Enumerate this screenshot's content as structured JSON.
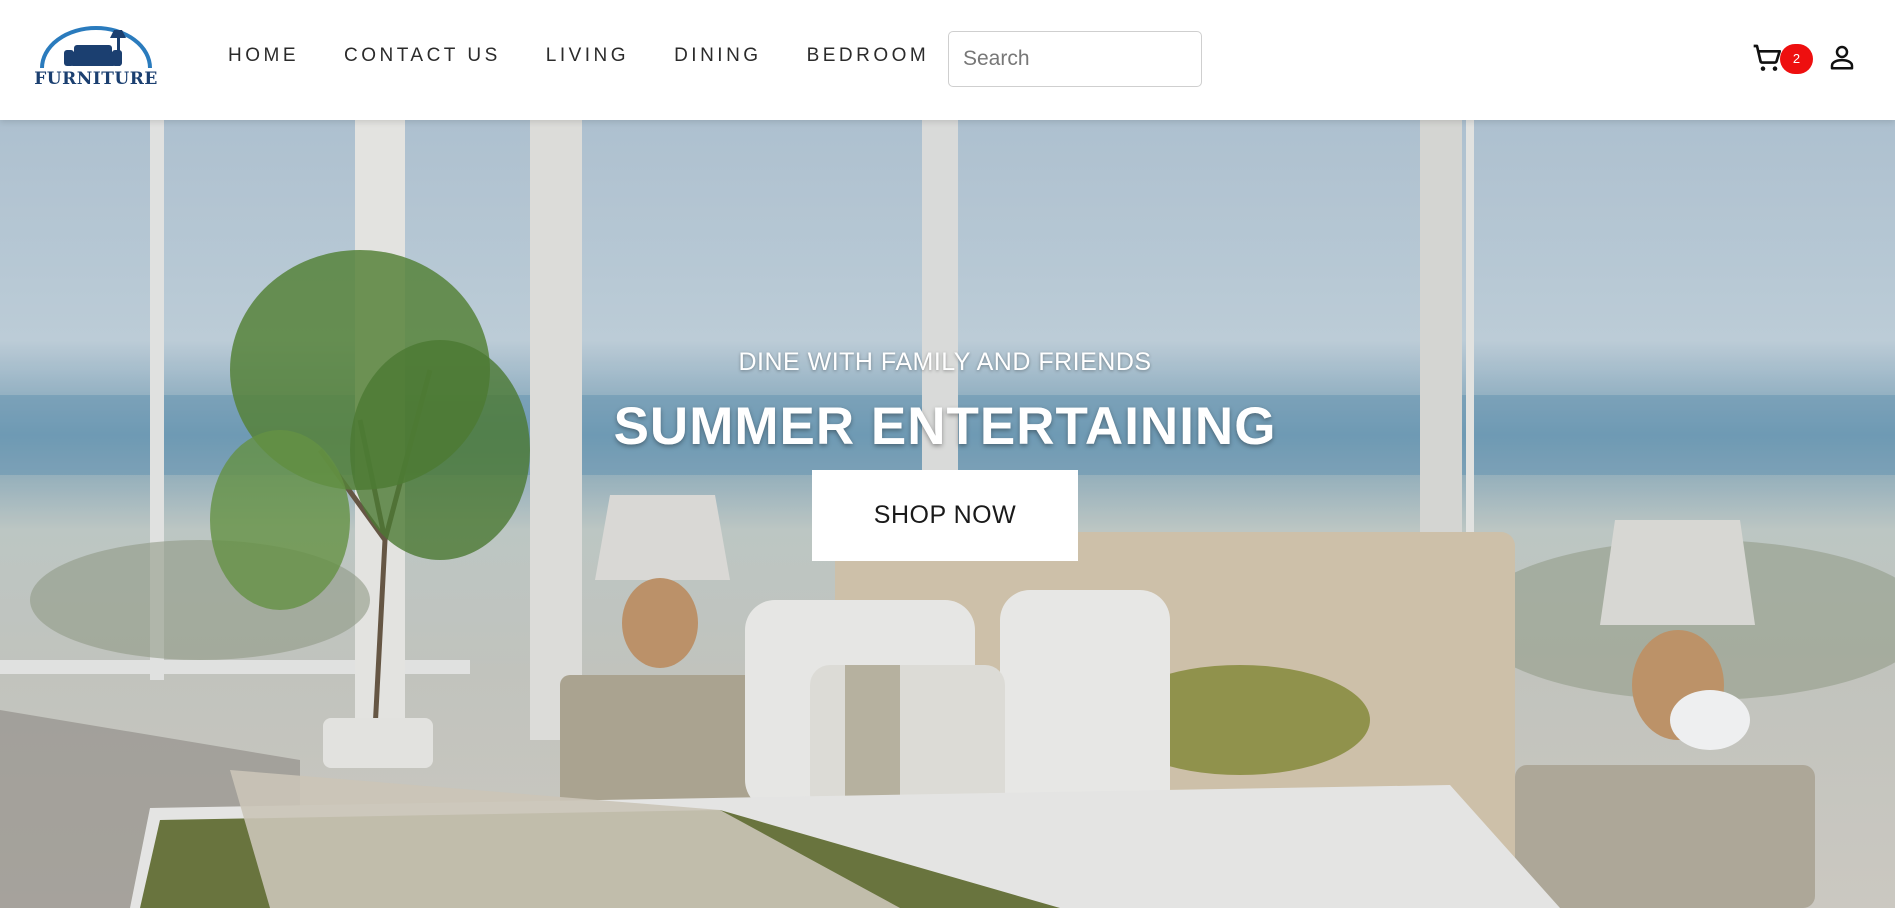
{
  "brand": {
    "logo_text": "FURNITURE",
    "primary_color": "#1b3f70",
    "accent_color": "#2a7bbd"
  },
  "nav": {
    "items": [
      {
        "label": "HOME"
      },
      {
        "label": "CONTACT US"
      },
      {
        "label": "LIVING"
      },
      {
        "label": "DINING"
      },
      {
        "label": "BEDROOM"
      }
    ]
  },
  "search": {
    "placeholder": "Search",
    "value": ""
  },
  "cart": {
    "icon": "cart-icon",
    "count": "2",
    "badge_color": "#ee0f0f"
  },
  "account": {
    "icon": "user-icon"
  },
  "hero": {
    "subtitle": "DINE WITH FAMILY AND FRIENDS",
    "title": "SUMMER ENTERTAINING",
    "cta_label": "SHOP NOW",
    "image": "bedroom-ocean-view-photo"
  }
}
